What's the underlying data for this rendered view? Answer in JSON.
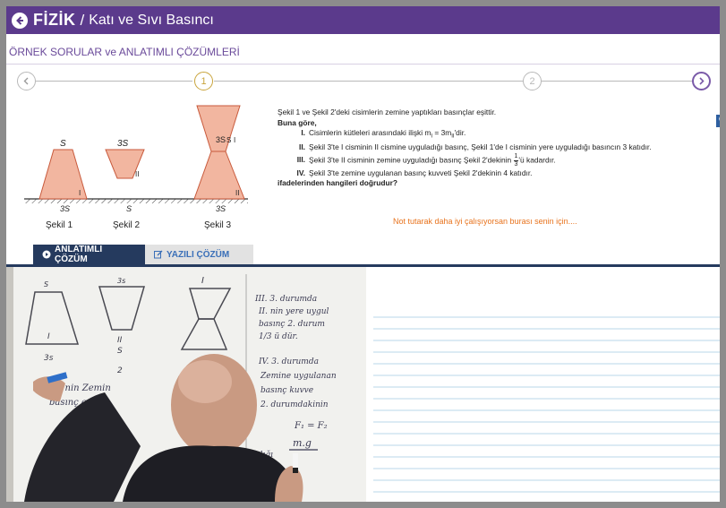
{
  "header": {
    "subject": "FİZİK",
    "separator": "/",
    "topic": "Katı ve Sıvı Basıncı",
    "bar_color": "#5b3a8c",
    "back_icon": "arrow-left-circle-icon"
  },
  "section_title": "ÖRNEK SORULAR ve ANLATIMLI ÇÖZÜMLERİ",
  "stepper": {
    "prev_icon": "chevron-left-icon",
    "next_icon": "chevron-right-icon",
    "steps": [
      "1",
      "2"
    ]
  },
  "figure": {
    "labels": {
      "s": "S",
      "s3": "3S",
      "roman1": "I",
      "roman2": "II"
    },
    "captions": [
      "Şekil 1",
      "Şekil 2",
      "Şekil 3"
    ]
  },
  "question": {
    "intro": "Şekil 1 ve Şekil 2'deki cisimlerin zemine yaptıkları basınçlar eşittir.",
    "lead": "Buna göre,",
    "items": [
      {
        "num": "I.",
        "text_before": "Cisimlerin kütleleri arasındaki ilişki m",
        "sub1": "I",
        "text_mid": " = 3m",
        "sub2": "II",
        "text_after": "'dir."
      },
      {
        "num": "II.",
        "text": "Şekil 3'te I cisminin II cismine uyguladığı basınç, Şekil 1'de I cisminin yere uyguladığı basıncın 3 katıdır."
      },
      {
        "num": "III.",
        "text_before": "Şekil 3'te II cisminin zemine uyguladığı basınç Şekil 2'dekinin ",
        "frac_num": "1",
        "frac_den": "3",
        "text_after": "'ü kadardır."
      },
      {
        "num": "IV.",
        "text": "Şekil 3'te zemine uygulanan basınç kuvveti Şekil 2'dekinin 4 katıdır."
      }
    ],
    "ask": "ifadelerinden hangileri doğrudur?"
  },
  "note": "Not tutarak daha iyi çalışıyorsan burası senin için....",
  "side_tab": "O",
  "tabs": [
    {
      "label": "ANLATIMLI ÇÖZÜM",
      "icon": "play-circle-icon"
    },
    {
      "label": "YAZILI ÇÖZÜM",
      "icon": "edit-icon"
    }
  ],
  "whiteboard": {
    "top_labels": [
      "S",
      "3s",
      "I"
    ],
    "shape_labels": [
      "I",
      "II",
      "S",
      "3s",
      "2"
    ],
    "notes_right": [
      "III. 3. durumda",
      "II. nin yere uygul",
      "basınç 2. durum",
      "1/3 ü dür.",
      "IV. 3. durumda",
      "Zemine uygulanan",
      "basınç kuvve",
      "2. durumdakinin"
    ],
    "equation_top": "F₁ = F₂",
    "equation_bottom": "m.g",
    "left_scribble": [
      "2 nin Zemin",
      "basınç eşitt"
    ],
    "bottom_scribble": "uyguladığı"
  },
  "colors": {
    "accent_purple": "#5b3a8c",
    "step_gold": "#c9a43c",
    "tab_active": "#253a5e",
    "tab_inactive_text": "#3a6fb8",
    "note_orange": "#e8731d",
    "shape_fill": "#f2b6a0",
    "shape_stroke": "#c85a3c",
    "ruled_line": "#b8d7ea"
  }
}
